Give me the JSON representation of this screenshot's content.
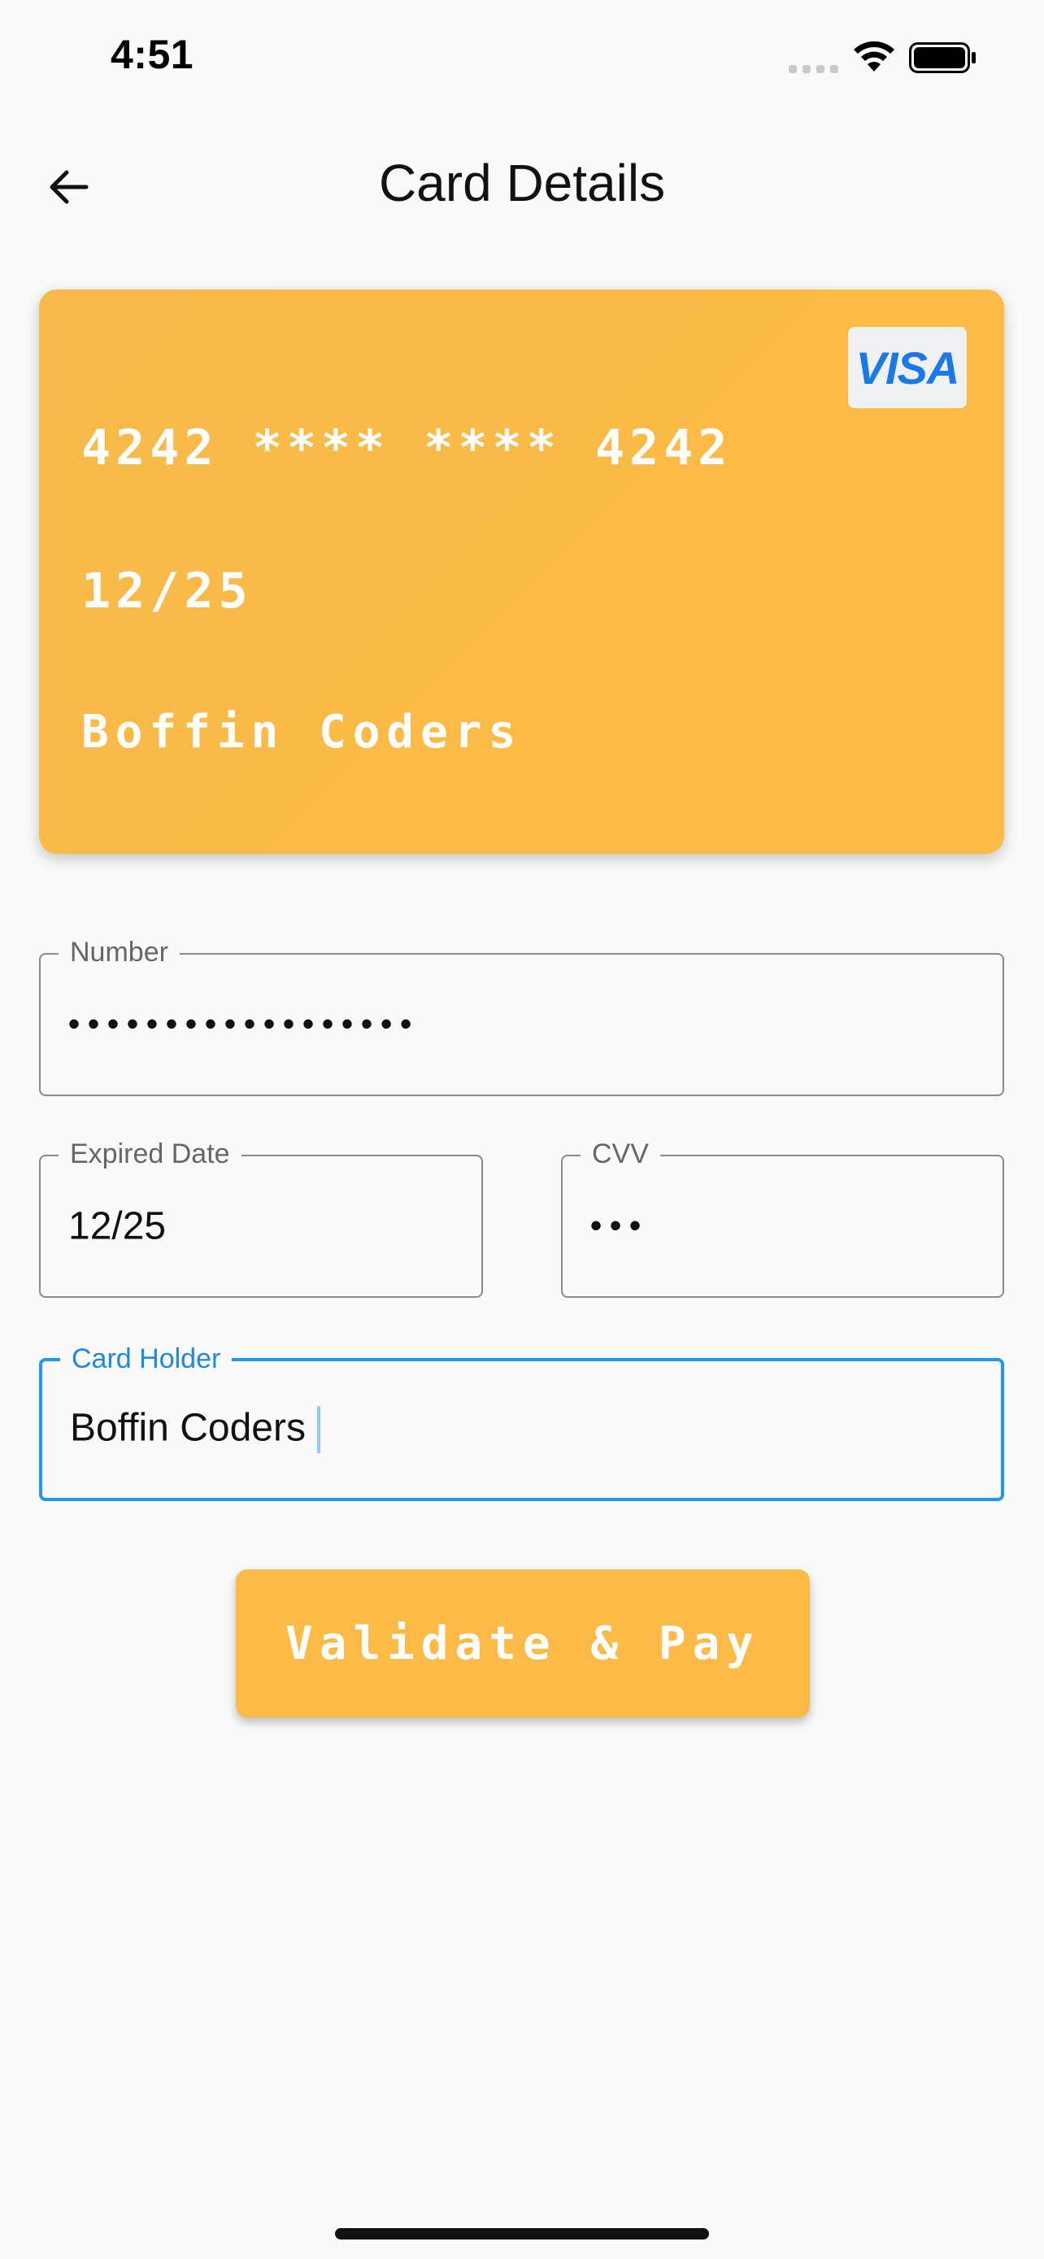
{
  "status_bar": {
    "time": "4:51"
  },
  "app_bar": {
    "title": "Card Details",
    "back_icon": "arrow-left-icon"
  },
  "card": {
    "brand": "VISA",
    "number": "4242 **** **** 4242",
    "expiry": "12/25",
    "holder": "Boffin Coders",
    "color": "#fbbb46"
  },
  "form": {
    "number": {
      "label": "Number",
      "value": "••••••••••••••••••"
    },
    "expiry": {
      "label": "Expired Date",
      "value": "12/25"
    },
    "cvv": {
      "label": "CVV",
      "value": "•••"
    },
    "holder": {
      "label": "Card Holder",
      "value": "Boffin Coders"
    }
  },
  "actions": {
    "pay_label": "Validate & Pay"
  },
  "colors": {
    "accent": "#fbbb46",
    "focus": "#2196f3"
  }
}
